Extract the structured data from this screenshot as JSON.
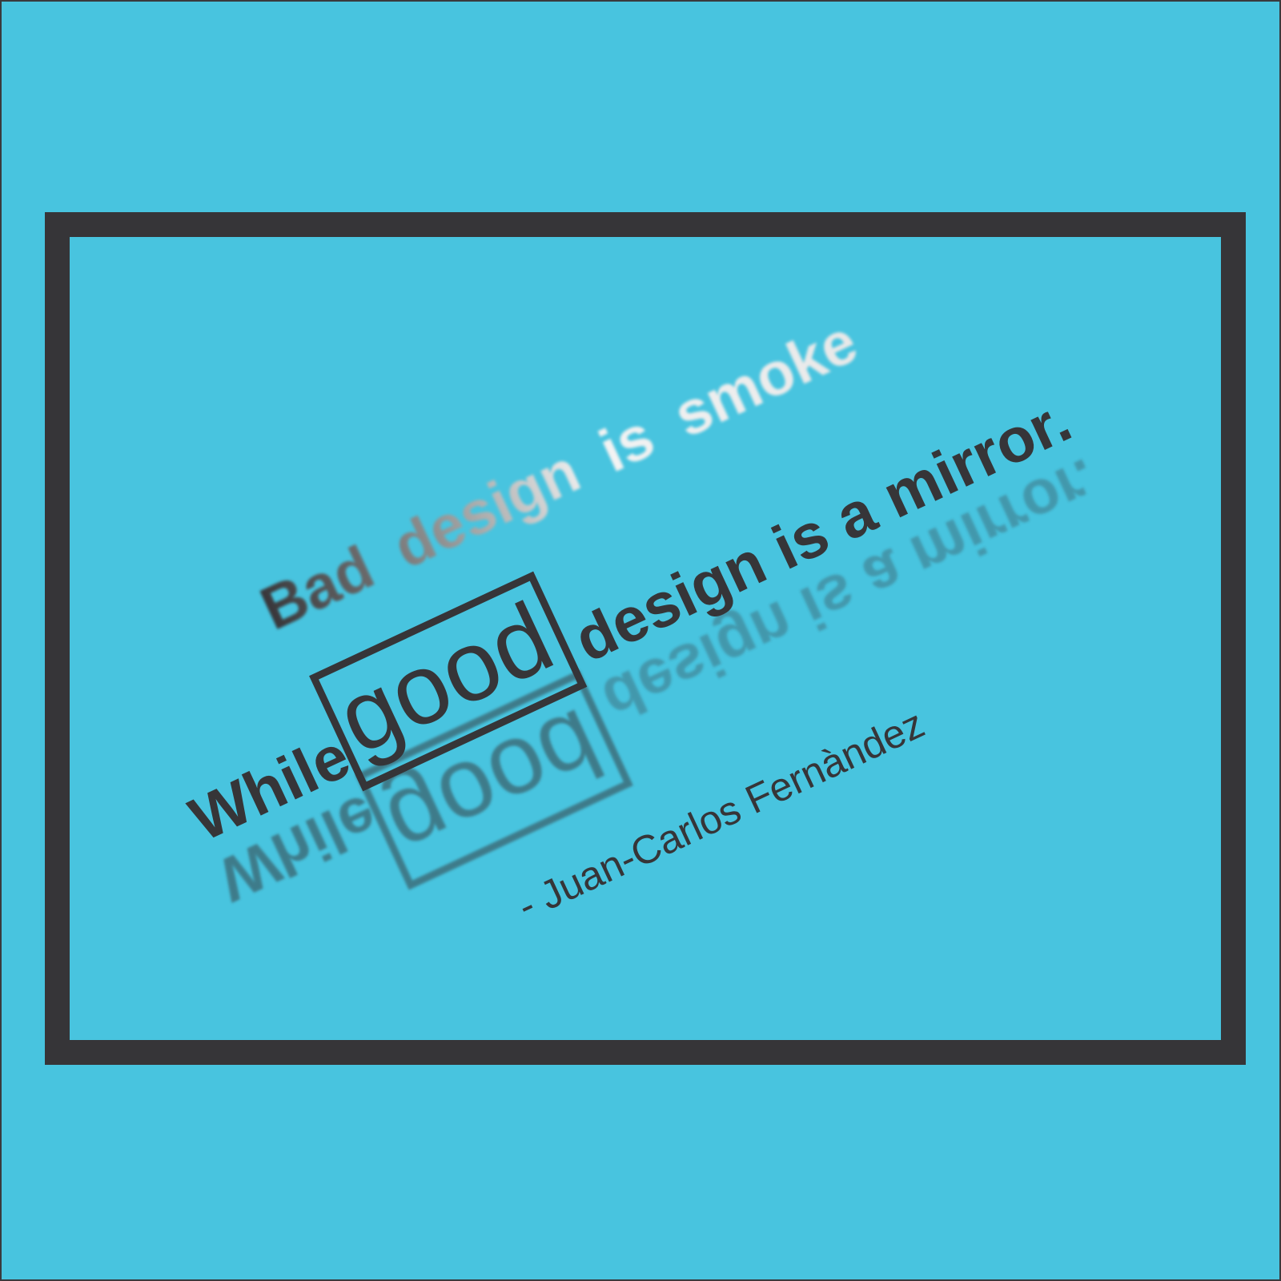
{
  "quote": {
    "line1": {
      "words": [
        "Bad",
        "design",
        "is",
        "smoke"
      ]
    },
    "line2": {
      "before": "While",
      "highlight": "good",
      "after": "design is a mirror."
    }
  },
  "attribution": "- Juan-Carlos Fernàndez",
  "colors": {
    "background": "#48c4df",
    "frame": "#363538",
    "text": "#363538",
    "smoke_gradient": [
      "#363538",
      "#8a8a8a",
      "#ffffff"
    ]
  }
}
